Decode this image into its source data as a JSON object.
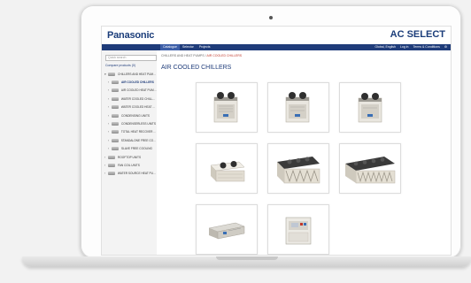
{
  "app": {
    "brand": "Panasonic",
    "title": "AC SELECT"
  },
  "nav": {
    "items": [
      {
        "label": "Catalogue",
        "active": true
      },
      {
        "label": "Selector",
        "active": false
      },
      {
        "label": "Projects",
        "active": false
      }
    ],
    "right": [
      "Global, English",
      "Log in",
      "Terms & Conditions",
      "⚙"
    ]
  },
  "sidebar": {
    "search_placeholder": "Quick search",
    "compare_link": "Compare products (0)",
    "items": [
      {
        "label": "CHILLERS AND HEAT PUMPS",
        "level": 0,
        "chevron": "▾"
      },
      {
        "label": "AIR COOLED CHILLERS",
        "level": 1,
        "chevron": "›",
        "active": true
      },
      {
        "label": "AIR COOLED HEAT PUMPS",
        "level": 1,
        "chevron": "›"
      },
      {
        "label": "WATER COOLED CHILLERS",
        "level": 1,
        "chevron": "›"
      },
      {
        "label": "WATER COOLED HEAT PU...",
        "level": 1,
        "chevron": "›"
      },
      {
        "label": "CONDENSING UNITS",
        "level": 1,
        "chevron": "›"
      },
      {
        "label": "CONDENSERLESS UNITS",
        "level": 1,
        "chevron": "›"
      },
      {
        "label": "TOTAL HEAT RECOVERY ...",
        "level": 1,
        "chevron": "›"
      },
      {
        "label": "STANDALONE FREE COOL...",
        "level": 1,
        "chevron": "›"
      },
      {
        "label": "SLAVE FREE COOLING",
        "level": 1,
        "chevron": "›"
      },
      {
        "label": "ROOFTOP UNITS",
        "level": 0,
        "chevron": "›"
      },
      {
        "label": "FAN COIL UNITS",
        "level": 0,
        "chevron": "›"
      },
      {
        "label": "WATER SOURCE HEAT PUM...",
        "level": 0,
        "chevron": "›"
      }
    ]
  },
  "main": {
    "breadcrumb_parent": "CHILLERS AND HEAT PUMPS",
    "breadcrumb_sep": "/",
    "breadcrumb_current": "AIR COOLED CHILLERS",
    "page_title": "AIR COOLED CHILLERS",
    "products": [
      {
        "type": "box-chiller"
      },
      {
        "type": "box-chiller"
      },
      {
        "type": "box-chiller"
      },
      {
        "type": "small-chiller"
      },
      {
        "type": "v-coil-chiller"
      },
      {
        "type": "long-chiller"
      },
      {
        "type": "ducted-unit"
      },
      {
        "type": "cabinet-unit"
      }
    ]
  },
  "colors": {
    "brand_blue": "#1b3d7a",
    "nav_bar": "#1f3c7a",
    "breadcrumb_current": "#c0392b"
  }
}
